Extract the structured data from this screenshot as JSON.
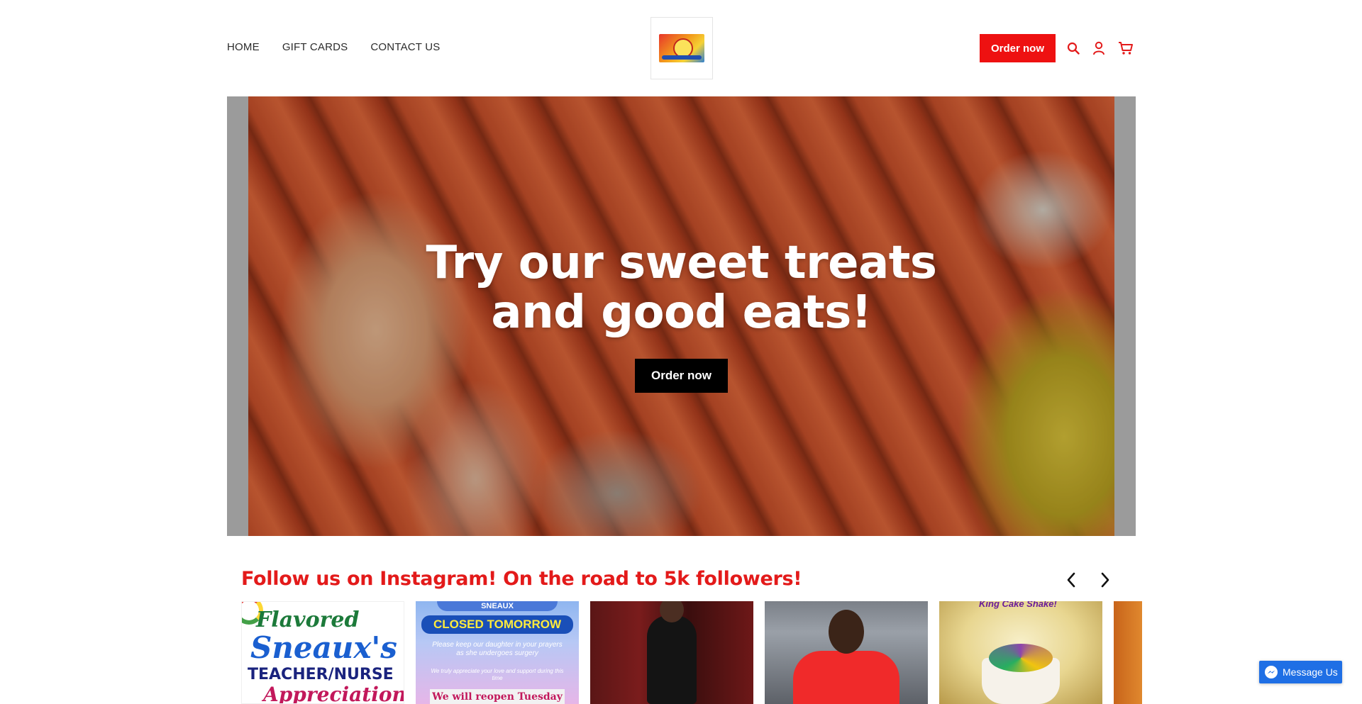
{
  "header": {
    "nav": [
      {
        "label": "HOME"
      },
      {
        "label": "GIFT CARDS"
      },
      {
        "label": "CONTACT US"
      }
    ],
    "order_button": "Order now",
    "icons": [
      "search-icon",
      "account-icon",
      "cart-icon"
    ],
    "accent_color": "#ee1111"
  },
  "hero": {
    "title_line1": "Try our sweet treats",
    "title_line2": "and good eats!",
    "button": "Order now"
  },
  "instagram": {
    "title": "Follow us on Instagram! On the road to 5k followers!",
    "title_color": "#e31a1a",
    "tiles": [
      {
        "lines": [
          "Flavored",
          "Sneaux's",
          "TEACHER/NURSE",
          "Appreciation"
        ]
      },
      {
        "badge": "SNEAUX",
        "headline": "CLOSED TOMORROW",
        "message": "Please keep our daughter in your prayers as she undergoes surgery",
        "message2": "We truly appreciate your love and support during this time",
        "footer": "We will reopen Tuesday"
      },
      {},
      {},
      {
        "caption": "King Cake Shake!"
      },
      {}
    ]
  },
  "messenger": {
    "label": "Message Us"
  }
}
